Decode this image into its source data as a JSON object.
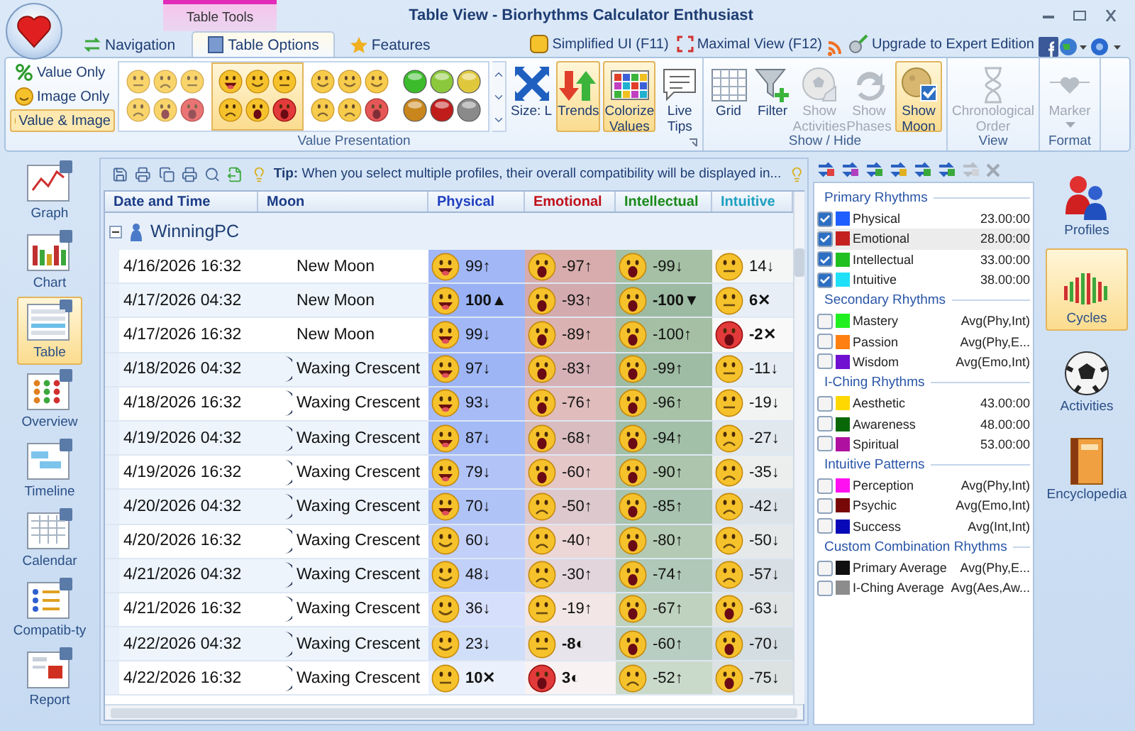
{
  "window": {
    "title": "Table View - Biorhythms Calculator Enthusiast",
    "contextual_tab": "Table Tools"
  },
  "tabs": [
    {
      "label": "Navigation",
      "selected": false
    },
    {
      "label": "Table Options",
      "selected": true
    },
    {
      "label": "Features",
      "selected": false
    }
  ],
  "quick_links": [
    "Simplified UI (F11)",
    "Maximal View (F12)",
    "Upgrade to Expert Edition"
  ],
  "value_presentation": {
    "label": "Value Presentation",
    "modes": [
      {
        "label": "Value Only",
        "selected": false
      },
      {
        "label": "Image Only",
        "selected": false
      },
      {
        "label": "Value & Image",
        "selected": true
      }
    ],
    "icon_sets": [
      {
        "kind": "faded",
        "selected": false
      },
      {
        "kind": "classic",
        "selected": true
      },
      {
        "kind": "flat",
        "selected": false
      },
      {
        "kind": "orbs",
        "selected": false
      }
    ],
    "size": "Size: L",
    "buttons": [
      {
        "label": "Trends",
        "selected": true
      },
      {
        "label": "Colorize Values",
        "selected": true
      },
      {
        "label": "Live Tips",
        "selected": false
      }
    ]
  },
  "show_hide": {
    "label": "Show / Hide",
    "buttons": [
      {
        "label": "Grid",
        "selected": false,
        "disabled": false
      },
      {
        "label": "Filter",
        "selected": false,
        "disabled": false
      },
      {
        "label": "Show Activities",
        "selected": false,
        "disabled": true
      },
      {
        "label": "Show Phases",
        "selected": false,
        "disabled": true
      },
      {
        "label": "Show Moon",
        "selected": true,
        "disabled": false
      }
    ]
  },
  "view": {
    "label": "View",
    "buttons": [
      {
        "label": "Chronological Order",
        "selected": false,
        "disabled": true
      }
    ]
  },
  "format": {
    "label": "Format",
    "buttons": [
      {
        "label": "Marker",
        "selected": false,
        "disabled": true
      }
    ]
  },
  "left_nav": [
    {
      "label": "Graph",
      "selected": false
    },
    {
      "label": "Chart",
      "selected": false
    },
    {
      "label": "Table",
      "selected": true
    },
    {
      "label": "Overview",
      "selected": false
    },
    {
      "label": "Timeline",
      "selected": false
    },
    {
      "label": "Calendar",
      "selected": false
    },
    {
      "label": "Compatib-ty",
      "selected": false
    },
    {
      "label": "Report",
      "selected": false
    }
  ],
  "table": {
    "tip": "**Tip:** When you select multiple profiles, their overall compatibility will be displayed in...",
    "columns": [
      {
        "label": "Date and Time",
        "color": "#1b3c87"
      },
      {
        "label": "Moon",
        "color": "#1b3c87"
      },
      {
        "label": "Physical",
        "color": "#1f3fbf"
      },
      {
        "label": "Emotional",
        "color": "#c0101a"
      },
      {
        "label": "Intellectual",
        "color": "#1a8a1a"
      },
      {
        "label": "Intuitive",
        "color": "#1fa0c0"
      }
    ],
    "group": "WinningPC",
    "rows": [
      {
        "date": "4/16/2026 16:32",
        "moon": "New Moon",
        "physical": {
          "kind": "grin",
          "value": "99↑",
          "critical": false
        },
        "emotional": {
          "kind": "shock",
          "value": "-97↑",
          "critical": false
        },
        "intellectual": {
          "kind": "shock",
          "value": "-99↓",
          "critical": false
        },
        "intuitive": {
          "kind": "neutral",
          "value": "14↓",
          "critical": false
        }
      },
      {
        "date": "4/17/2026 04:32",
        "moon": "New Moon",
        "physical": {
          "kind": "grin",
          "value": "100▲",
          "critical": true
        },
        "emotional": {
          "kind": "shock",
          "value": "-93↑",
          "critical": false
        },
        "intellectual": {
          "kind": "shock",
          "value": "-100▼",
          "critical": true
        },
        "intuitive": {
          "kind": "neutral",
          "value": "6✕",
          "critical": true
        }
      },
      {
        "date": "4/17/2026 16:32",
        "moon": "New Moon",
        "physical": {
          "kind": "grin",
          "value": "99↓",
          "critical": false
        },
        "emotional": {
          "kind": "shock",
          "value": "-89↑",
          "critical": false
        },
        "intellectual": {
          "kind": "shock",
          "value": "-100↑",
          "critical": false
        },
        "intuitive": {
          "kind": "red-shock",
          "value": "-2✕",
          "critical": true
        }
      },
      {
        "date": "4/18/2026 04:32",
        "moon": "Waxing Crescent",
        "physical": {
          "kind": "grin",
          "value": "97↓",
          "critical": false
        },
        "emotional": {
          "kind": "shock",
          "value": "-83↑",
          "critical": false
        },
        "intellectual": {
          "kind": "shock",
          "value": "-99↑",
          "critical": false
        },
        "intuitive": {
          "kind": "neutral",
          "value": "-11↓",
          "critical": false
        },
        "kind": "crescent"
      },
      {
        "date": "4/18/2026 16:32",
        "moon": "Waxing Crescent",
        "physical": {
          "kind": "grin",
          "value": "93↓",
          "critical": false
        },
        "emotional": {
          "kind": "shock",
          "value": "-76↑",
          "critical": false
        },
        "intellectual": {
          "kind": "shock",
          "value": "-96↑",
          "critical": false
        },
        "intuitive": {
          "kind": "neutral",
          "value": "-19↓",
          "critical": false
        },
        "kind": "crescent"
      },
      {
        "date": "4/19/2026 04:32",
        "moon": "Waxing Crescent",
        "physical": {
          "kind": "grin",
          "value": "87↓",
          "critical": false
        },
        "emotional": {
          "kind": "shock",
          "value": "-68↑",
          "critical": false
        },
        "intellectual": {
          "kind": "shock",
          "value": "-94↑",
          "critical": false
        },
        "intuitive": {
          "kind": "frown",
          "value": "-27↓",
          "critical": false
        },
        "kind": "crescent"
      },
      {
        "date": "4/19/2026 16:32",
        "moon": "Waxing Crescent",
        "physical": {
          "kind": "grin",
          "value": "79↓",
          "critical": false
        },
        "emotional": {
          "kind": "shock",
          "value": "-60↑",
          "critical": false
        },
        "intellectual": {
          "kind": "shock",
          "value": "-90↑",
          "critical": false
        },
        "intuitive": {
          "kind": "frown",
          "value": "-35↓",
          "critical": false
        },
        "kind": "crescent"
      },
      {
        "date": "4/20/2026 04:32",
        "moon": "Waxing Crescent",
        "physical": {
          "kind": "grin",
          "value": "70↓",
          "critical": false
        },
        "emotional": {
          "kind": "frown",
          "value": "-50↑",
          "critical": false
        },
        "intellectual": {
          "kind": "shock",
          "value": "-85↑",
          "critical": false
        },
        "intuitive": {
          "kind": "frown",
          "value": "-42↓",
          "critical": false
        },
        "kind": "crescent"
      },
      {
        "date": "4/20/2026 16:32",
        "moon": "Waxing Crescent",
        "physical": {
          "kind": "smile",
          "value": "60↓",
          "critical": false
        },
        "emotional": {
          "kind": "frown",
          "value": "-40↑",
          "critical": false
        },
        "intellectual": {
          "kind": "shock",
          "value": "-80↑",
          "critical": false
        },
        "intuitive": {
          "kind": "frown",
          "value": "-50↓",
          "critical": false
        },
        "kind": "crescent"
      },
      {
        "date": "4/21/2026 04:32",
        "moon": "Waxing Crescent",
        "physical": {
          "kind": "smile",
          "value": "48↓",
          "critical": false
        },
        "emotional": {
          "kind": "frown",
          "value": "-30↑",
          "critical": false
        },
        "intellectual": {
          "kind": "shock",
          "value": "-74↑",
          "critical": false
        },
        "intuitive": {
          "kind": "frown",
          "value": "-57↓",
          "critical": false
        },
        "kind": "crescent"
      },
      {
        "date": "4/21/2026 16:32",
        "moon": "Waxing Crescent",
        "physical": {
          "kind": "smile",
          "value": "36↓",
          "critical": false
        },
        "emotional": {
          "kind": "neutral",
          "value": "-19↑",
          "critical": false
        },
        "intellectual": {
          "kind": "shock",
          "value": "-67↑",
          "critical": false
        },
        "intuitive": {
          "kind": "shock",
          "value": "-63↓",
          "critical": false
        },
        "kind": "crescent"
      },
      {
        "date": "4/22/2026 04:32",
        "moon": "Waxing Crescent",
        "physical": {
          "kind": "smile",
          "value": "23↓",
          "critical": false
        },
        "emotional": {
          "kind": "neutral",
          "value": "-8◐",
          "critical": true
        },
        "intellectual": {
          "kind": "shock",
          "value": "-60↑",
          "critical": false
        },
        "intuitive": {
          "kind": "shock",
          "value": "-70↓",
          "critical": false
        },
        "kind": "crescent"
      },
      {
        "date": "4/22/2026 16:32",
        "moon": "Waxing Crescent",
        "physical": {
          "kind": "neutral",
          "value": "10✕",
          "critical": true
        },
        "emotional": {
          "kind": "red-shock",
          "value": "3◐",
          "critical": true
        },
        "intellectual": {
          "kind": "frown",
          "value": "-52↑",
          "critical": false
        },
        "intuitive": {
          "kind": "shock",
          "value": "-75↓",
          "critical": false
        },
        "kind": "crescent"
      }
    ]
  },
  "rhythms": [
    {
      "title": "Primary Rhythms",
      "items": [
        {
          "name": "Physical",
          "color": "#1f5fff",
          "value": "23.00:00",
          "checked": true,
          "selected": false
        },
        {
          "name": "Emotional",
          "color": "#c42020",
          "value": "28.00:00",
          "checked": true,
          "selected": true
        },
        {
          "name": "Intellectual",
          "color": "#20c020",
          "value": "33.00:00",
          "checked": true,
          "selected": false
        },
        {
          "name": "Intuitive",
          "color": "#20e0f8",
          "value": "38.00:00",
          "checked": true,
          "selected": false
        }
      ]
    },
    {
      "title": "Secondary Rhythms",
      "items": [
        {
          "name": "Mastery",
          "color": "#20f020",
          "value": "Avg(Phy,Int)",
          "checked": false,
          "selected": false
        },
        {
          "name": "Passion",
          "color": "#ff7f10",
          "value": "Avg(Phy,E...",
          "checked": false,
          "selected": false
        },
        {
          "name": "Wisdom",
          "color": "#7010d0",
          "value": "Avg(Emo,Int)",
          "checked": false,
          "selected": false
        }
      ]
    },
    {
      "title": "I-Ching Rhythms",
      "items": [
        {
          "name": "Aesthetic",
          "color": "#ffd800",
          "value": "43.00:00",
          "checked": false,
          "selected": false
        },
        {
          "name": "Awareness",
          "color": "#086808",
          "value": "48.00:00",
          "checked": false,
          "selected": false
        },
        {
          "name": "Spiritual",
          "color": "#b010a0",
          "value": "53.00:00",
          "checked": false,
          "selected": false
        }
      ]
    },
    {
      "title": "Intuitive Patterns",
      "items": [
        {
          "name": "Perception",
          "color": "#ff10f0",
          "value": "Avg(Phy,Int)",
          "checked": false,
          "selected": false
        },
        {
          "name": "Psychic",
          "color": "#780808",
          "value": "Avg(Emo,Int)",
          "checked": false,
          "selected": false
        },
        {
          "name": "Success",
          "color": "#0808b8",
          "value": "Avg(Int,Int)",
          "checked": false,
          "selected": false
        }
      ]
    },
    {
      "title": "Custom Combination Rhythms",
      "items": [
        {
          "name": "Primary Average",
          "color": "#101010",
          "value": "Avg(Phy,E...",
          "checked": false,
          "selected": false
        },
        {
          "name": "I-Ching Average",
          "color": "#8c8c8c",
          "value": "Avg(Aes,Aw...",
          "checked": false,
          "selected": false
        }
      ]
    }
  ],
  "right_nav": [
    {
      "label": "Profiles",
      "selected": false
    },
    {
      "label": "Cycles",
      "selected": true
    },
    {
      "label": "Activities",
      "selected": false
    },
    {
      "label": "Encyclopedia",
      "selected": false
    }
  ]
}
